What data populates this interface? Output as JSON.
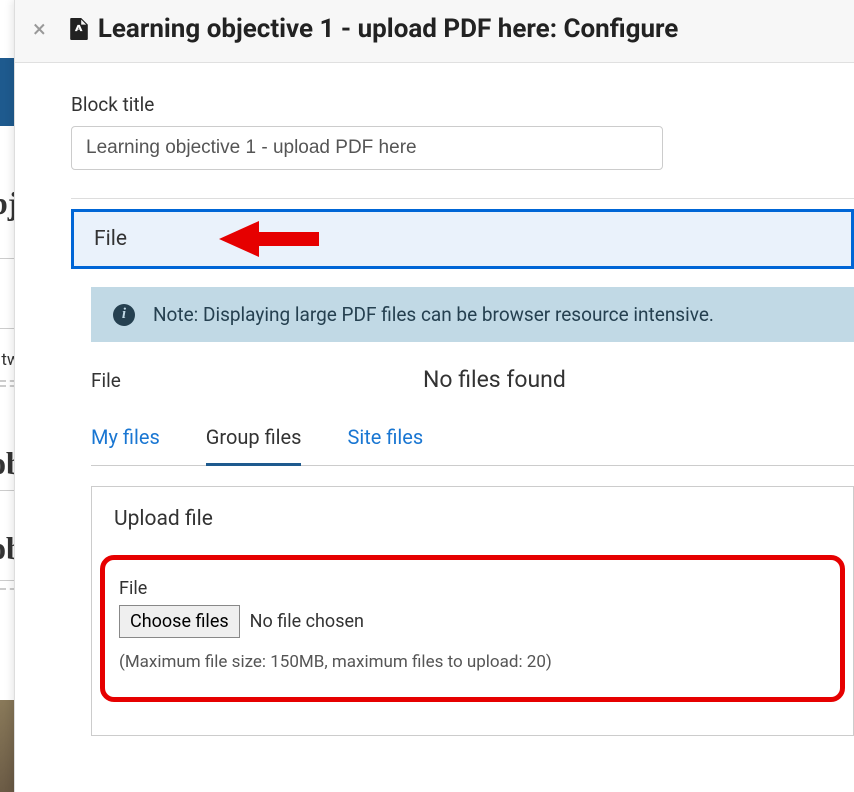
{
  "modal": {
    "title": "Learning objective 1 - upload PDF here: Configure",
    "block_title_label": "Block title",
    "block_title_value": "Learning objective 1 - upload PDF here"
  },
  "file_section": {
    "heading": "File",
    "note": "Note: Displaying large PDF files can be browser resource intensive.",
    "file_label": "File",
    "no_files": "No files found"
  },
  "tabs": {
    "my_files": "My files",
    "group_files": "Group files",
    "site_files": "Site files"
  },
  "upload": {
    "title": "Upload file",
    "file_label": "File",
    "choose_btn": "Choose files",
    "no_file_chosen": "No file chosen",
    "hint": "(Maximum file size: 150MB, maximum files to upload: 20)"
  },
  "background": {
    "bj1": "bj",
    "bj2": "obj",
    "bj3": "obj",
    "two": "ve two"
  }
}
